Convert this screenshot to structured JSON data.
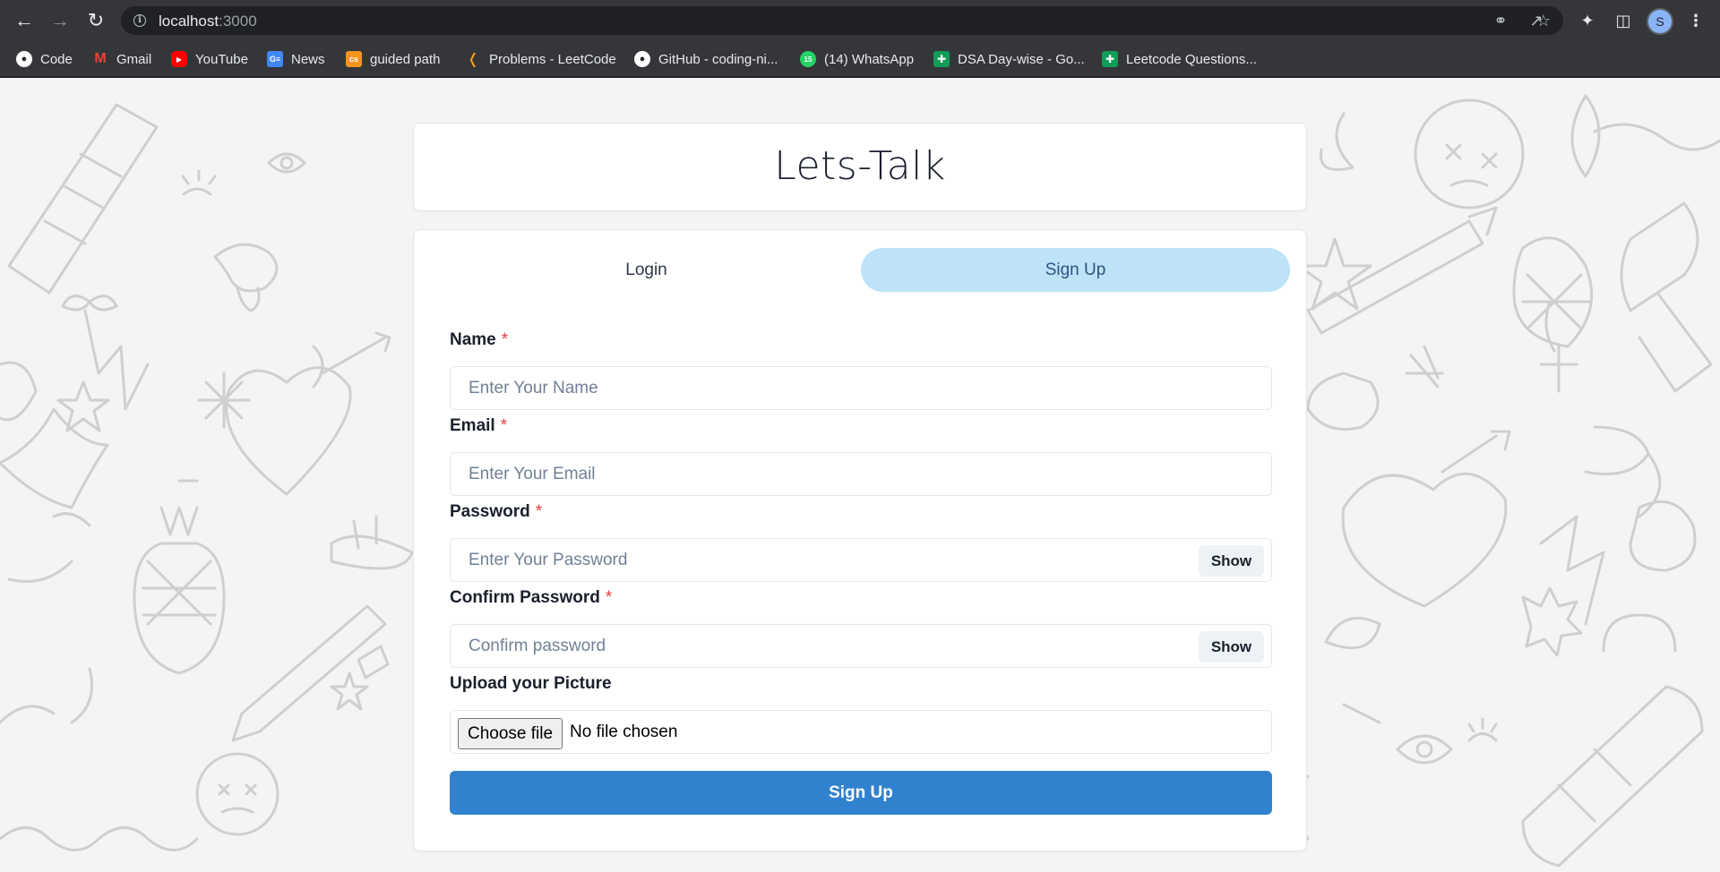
{
  "browser": {
    "url_host": "localhost",
    "url_port": ":3000",
    "profile_initial": "S",
    "bookmarks": [
      {
        "label": "Code",
        "icon": "github-icon",
        "color": "#ffffff"
      },
      {
        "label": "Gmail",
        "icon": "gmail-icon",
        "color": "#ea4335"
      },
      {
        "label": "YouTube",
        "icon": "youtube-icon",
        "color": "#ff0000"
      },
      {
        "label": "News",
        "icon": "google-news-icon",
        "color": "#4285f4"
      },
      {
        "label": "guided path",
        "icon": "codestudio-icon",
        "color": "#f7941d"
      },
      {
        "label": "Problems - LeetCode",
        "icon": "leetcode-icon",
        "color": "#ffa116"
      },
      {
        "label": "GitHub - coding-ni...",
        "icon": "github-icon",
        "color": "#ffffff"
      },
      {
        "label": "(14) WhatsApp",
        "icon": "whatsapp-icon",
        "color": "#25d366"
      },
      {
        "label": "DSA Day-wise - Go...",
        "icon": "google-sheets-icon",
        "color": "#0f9d58"
      },
      {
        "label": "Leetcode Questions...",
        "icon": "google-sheets-icon",
        "color": "#0f9d58"
      }
    ]
  },
  "app": {
    "title": "Lets-Talk"
  },
  "tabs": {
    "login": "Login",
    "signup": "Sign Up"
  },
  "form": {
    "name": {
      "label": "Name",
      "required": "*",
      "placeholder": "Enter Your Name"
    },
    "email": {
      "label": "Email",
      "required": "*",
      "placeholder": "Enter Your Email"
    },
    "password": {
      "label": "Password",
      "required": "*",
      "placeholder": "Enter Your Password",
      "toggle": "Show"
    },
    "confirm": {
      "label": "Confirm Password",
      "required": "*",
      "placeholder": "Confirm password",
      "toggle": "Show"
    },
    "picture": {
      "label": "Upload your Picture",
      "button": "Choose file",
      "status": "No file chosen"
    },
    "submit": "Sign Up"
  },
  "colors": {
    "accent": "#3182ce",
    "active_tab": "#bee3f8",
    "required": "#e53e3e"
  }
}
